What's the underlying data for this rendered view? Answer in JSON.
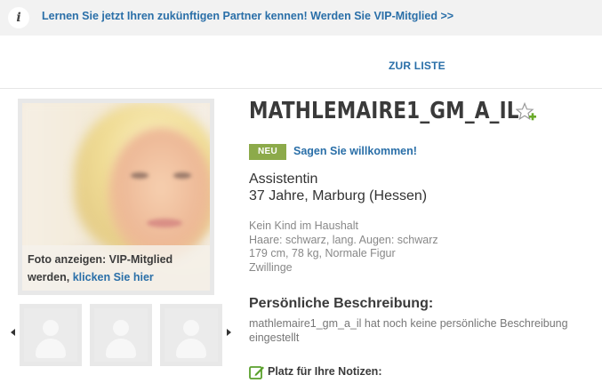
{
  "banner": {
    "info_icon_glyph": "i",
    "text": "Lernen Sie jetzt Ihren zukünftigen Partner kennen! Werden Sie VIP-Mitglied >>"
  },
  "nav": {
    "back_to_list": "ZUR LISTE"
  },
  "photo": {
    "caption_text": "Foto anzeigen: VIP-Mitglied werden,",
    "caption_link": "klicken Sie hier"
  },
  "thumbnails": {
    "count": 3,
    "icon": "avatar-placeholder-icon"
  },
  "profile": {
    "username": "MATHLEMAIRE1_GM_A_IL",
    "badge": "NEU",
    "welcome_link": "Sagen Sie willkommen!",
    "occupation": "Assistentin",
    "age_location": "37 Jahre, Marburg (Hessen)",
    "details": [
      "Kein Kind im Haushalt",
      "Haare: schwarz, lang. Augen: schwarz",
      "179 cm, 78 kg, Normale Figur",
      "Zwillinge"
    ],
    "description_title": "Persönliche Beschreibung:",
    "description_text": "mathlemaire1_gm_a_il hat noch keine persönliche Beschreibung eingestellt",
    "notes_label": "Platz für Ihre Notizen:"
  },
  "colors": {
    "link": "#2a6fa8",
    "badge_new": "#8caa4a",
    "banner_bg": "#f2f2f2",
    "fav_star_plus": "#6aaa2a"
  }
}
